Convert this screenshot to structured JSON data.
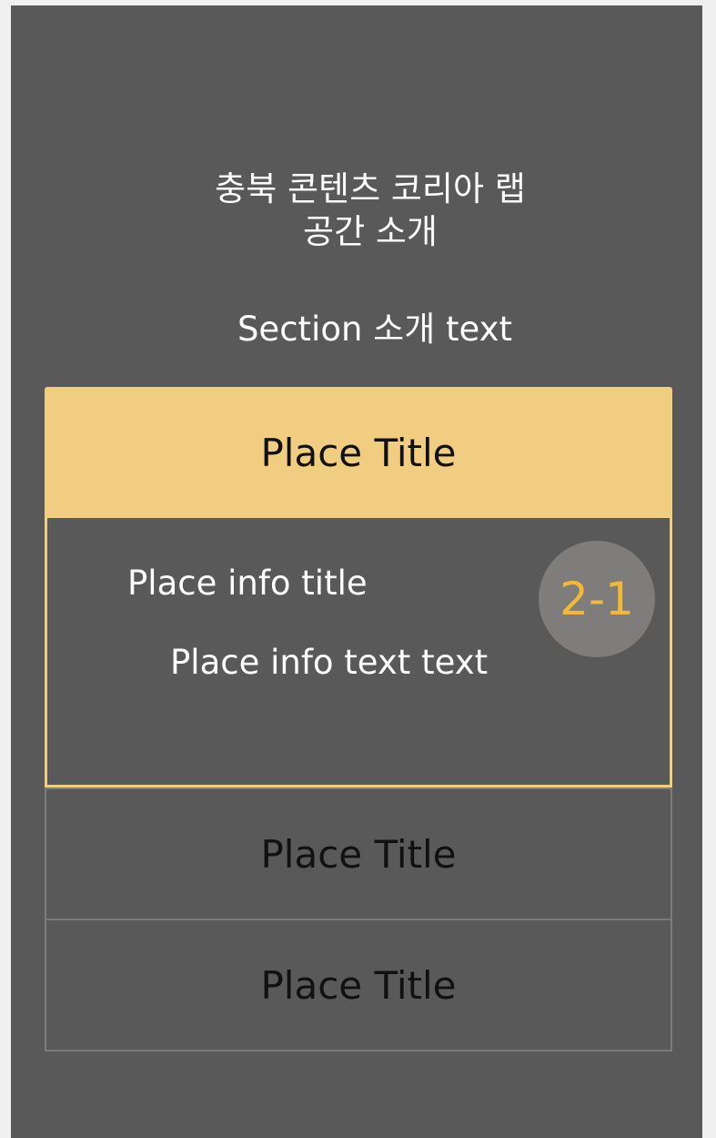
{
  "header": {
    "title_line1": "충북 콘텐츠 코리아 랩",
    "title_line2": "공간 소개",
    "section_intro": "Section 소개 text"
  },
  "places": [
    {
      "title": "Place Title",
      "expanded": true,
      "info_title": "Place info title",
      "info_text": "Place info text text",
      "badge": "2-1"
    },
    {
      "title": "Place Title",
      "expanded": false
    },
    {
      "title": "Place Title",
      "expanded": false
    }
  ],
  "colors": {
    "screen_bg": "#5a5959",
    "accent": "#f1cd82",
    "badge_bg": "#7e7d7c",
    "badge_text": "#f2b937"
  }
}
